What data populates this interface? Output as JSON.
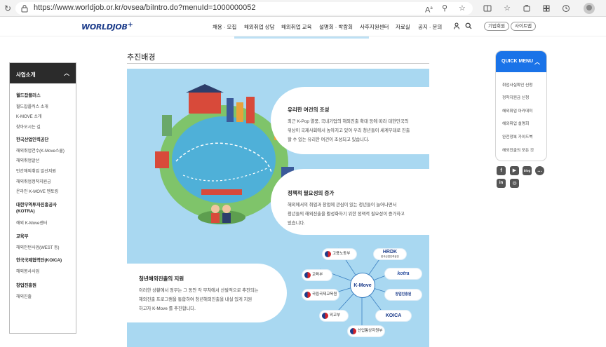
{
  "browser": {
    "url": "https://www.worldjob.or.kr/ovsea/biIntro.do?menuId=1000000052"
  },
  "header": {
    "logo": "WORLDJOB",
    "logo_plus": "+",
    "nav": [
      "채용 · 모집",
      "해외취업 상담",
      "해외취업 교육",
      "설명회 · 박람회",
      "사후지원센터",
      "자료실",
      "공지 · 문의"
    ],
    "member_btn": "기업회원",
    "sitemap_btn": "사이트맵"
  },
  "sidebar": {
    "title": "사업소개",
    "groups": [
      {
        "title": "월드잡플러스",
        "items": [
          "월드잡플러스 소개",
          "K-MOVE 소개",
          "찾아오시는 길"
        ]
      },
      {
        "title": "한국산업인력공단",
        "items": [
          "해외취업연수(K-Move스쿨)",
          "해외취업알선",
          "민간해외취업 알선지원",
          "해외취업정착지원금",
          "온라인 K-MOVE 멘토링"
        ]
      },
      {
        "title": "대한무역투자진흥공사 (KOTRA)",
        "items": [
          "해외 K-Move센터"
        ]
      },
      {
        "title": "교육부",
        "items": [
          "해외인턴사업(WEST 등)"
        ]
      },
      {
        "title": "한국국제협력단(KOICA)",
        "items": [
          "해외봉사사업"
        ]
      },
      {
        "title": "창업진흥원",
        "items": [
          "해외진출"
        ]
      }
    ]
  },
  "main": {
    "title": "추진배경",
    "sections": [
      {
        "title": "유리한 여건의 조성",
        "lines": [
          "최근 K-Pop 열풍, 국내기업의 해외진출 확대 등에 따라 대한민국의",
          "위상이 국제사회에서 높아지고 있어 우리 청년들이 세계무대로 진출",
          "할 수 있는 유리한 여건이 조성되고 있습니다."
        ]
      },
      {
        "title": "정책적 필요성의 증가",
        "lines": [
          "해외에서의 취업과 창업에 관심이 있는 청년들이 늘어나면서",
          "청년들의 해외진출을 활성화하기 위한 정책적 필요성이 증가하고",
          "있습니다."
        ]
      },
      {
        "title": "청년해외진출의 지원",
        "lines": [
          "이러한 상황에서 정부는 그 동안 각 부처에서 산발적으로 추진되는",
          "해외진출 프로그램을 통합하여 청년해외진출을 내실 있게 지원",
          "하고자 K-Move 를 추진합니다."
        ]
      }
    ],
    "center_logo": "K-Move",
    "orgs": {
      "labor": "고용노동부",
      "edu": "교육부",
      "nipa": "국립국제교육원",
      "mofa": "외교부",
      "motie": "산업통상자원부",
      "hrdk": "HRDK",
      "hrdk_sub": "한국산업인력공단",
      "kotra": "kotra",
      "kosmes": "창업진흥원",
      "koica": "KOICA"
    }
  },
  "quick": {
    "title": "QUICK MENU",
    "items": [
      "취업사실확인 신청",
      "정착지원금 신청",
      "해외취업 아카데미",
      "해외취업 설명회",
      "완전정복 가이드북",
      "해외진출의 모든 것"
    ]
  },
  "sns": [
    "facebook-icon",
    "youtube-icon",
    "blog-icon",
    "talk-icon",
    "linkedin-icon",
    "instagram-icon"
  ],
  "colors": {
    "brand": "#1b3b8a",
    "quick": "#1a73e8",
    "hero": "#a9d8f1"
  }
}
